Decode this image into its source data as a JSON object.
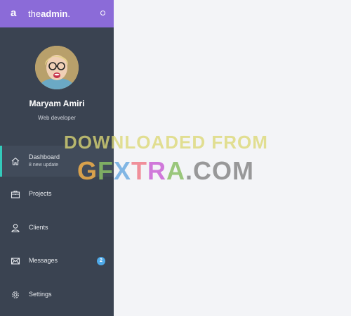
{
  "brand": {
    "logo_letter": "a",
    "name_prefix": "the",
    "name_bold": "admin",
    "name_suffix": "."
  },
  "profile": {
    "name": "Maryam Amiri",
    "role": "Web developer"
  },
  "nav": [
    {
      "label": "Dashboard",
      "sub": "8 new update",
      "icon": "home-icon",
      "active": true
    },
    {
      "label": "Projects",
      "icon": "briefcase-icon"
    },
    {
      "label": "Clients",
      "icon": "user-icon"
    },
    {
      "label": "Messages",
      "icon": "envelope-icon",
      "badge": "2"
    },
    {
      "label": "Settings",
      "icon": "gear-icon"
    }
  ],
  "watermark": {
    "line1": "DOWNLOADED FROM",
    "line2_parts": [
      "G",
      "F",
      "X",
      "T",
      "R",
      "A",
      ".COM"
    ]
  },
  "colors": {
    "sidebar": "#3a4351",
    "topbar": "#8b6bd8",
    "accent": "#33cabb",
    "badge": "#4ea9e8",
    "main_bg": "#f3f4f7"
  }
}
